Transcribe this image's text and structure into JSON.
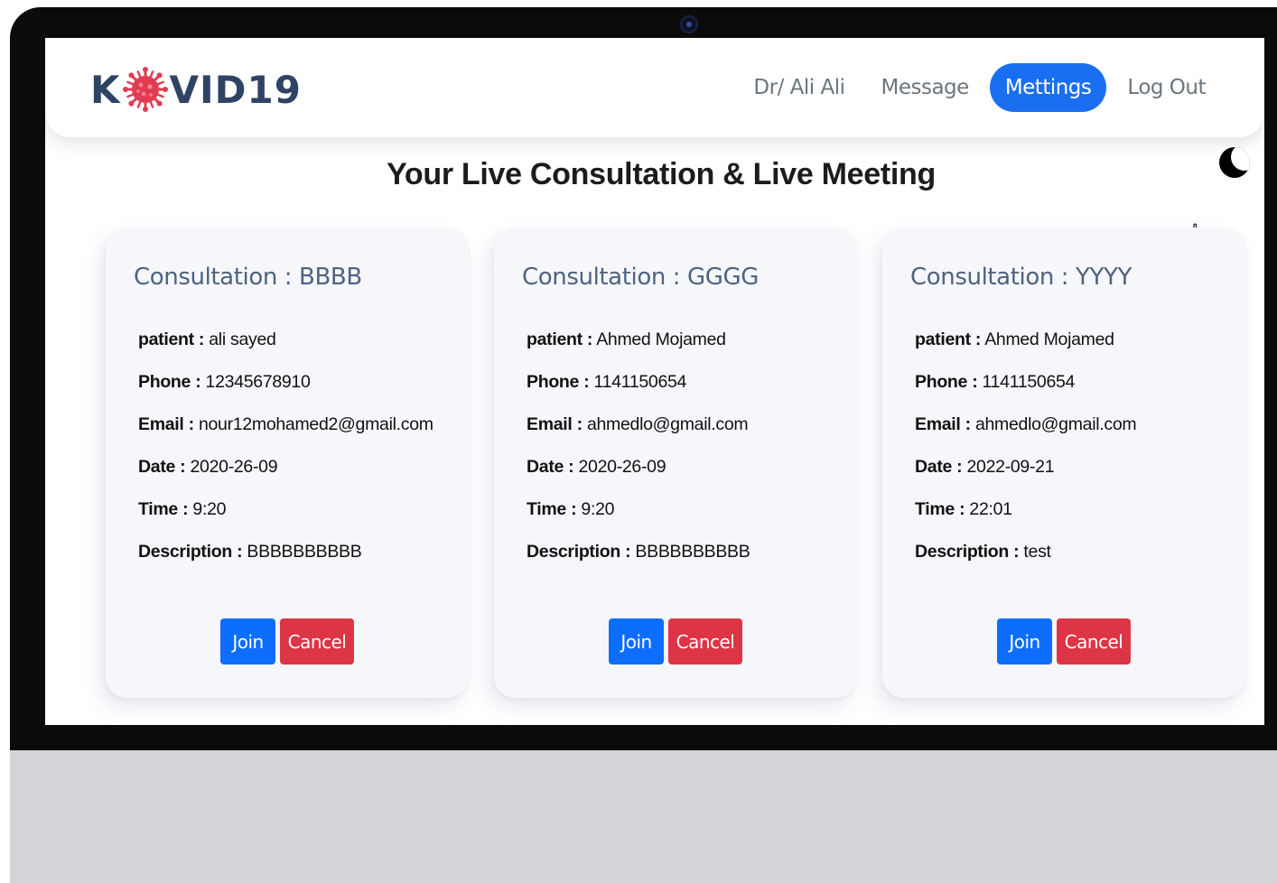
{
  "brand": {
    "logo_left": "K",
    "logo_right": "VID19"
  },
  "nav": {
    "items": [
      {
        "label": "Dr/ Ali Ali",
        "active": false
      },
      {
        "label": "Message",
        "active": false
      },
      {
        "label": "Mettings",
        "active": true
      },
      {
        "label": "Log Out",
        "active": false
      }
    ]
  },
  "page": {
    "title": "Your Live Consultation & Live Meeting"
  },
  "labels": {
    "patient": "patient :",
    "phone": "Phone :",
    "email": "Email :",
    "date": "Date :",
    "time": "Time :",
    "description": "Description :"
  },
  "cards": [
    {
      "title": "Consultation : BBBB",
      "patient": "ali sayed",
      "phone": "12345678910",
      "email": "nour12mohamed2@gmail.com",
      "date": "2020-26-09",
      "time": "9:20",
      "description": "BBBBBBBBBB",
      "join_label": "Join",
      "cancel_label": "Cancel"
    },
    {
      "title": "Consultation : GGGG",
      "patient": "Ahmed Mojamed",
      "phone": "1141150654",
      "email": "ahmedlo@gmail.com",
      "date": "2020-26-09",
      "time": "9:20",
      "description": "BBBBBBBBBB",
      "join_label": "Join",
      "cancel_label": "Cancel"
    },
    {
      "title": "Consultation : YYYY",
      "patient": "Ahmed Mojamed",
      "phone": "1141150654",
      "email": "ahmedlo@gmail.com",
      "date": "2022-09-21",
      "time": "22:01",
      "description": "test",
      "join_label": "Join",
      "cancel_label": "Cancel"
    }
  ],
  "colors": {
    "primary": "#1a6ff0",
    "join": "#0d6efd",
    "cancel": "#dc3545",
    "logo_text": "#2f4364",
    "virus": "#e23b52",
    "card_title": "#4e6380"
  },
  "icons": {
    "virus": "virus-icon",
    "theme": "moon-icon",
    "cursor": "hand-pointer-icon"
  }
}
